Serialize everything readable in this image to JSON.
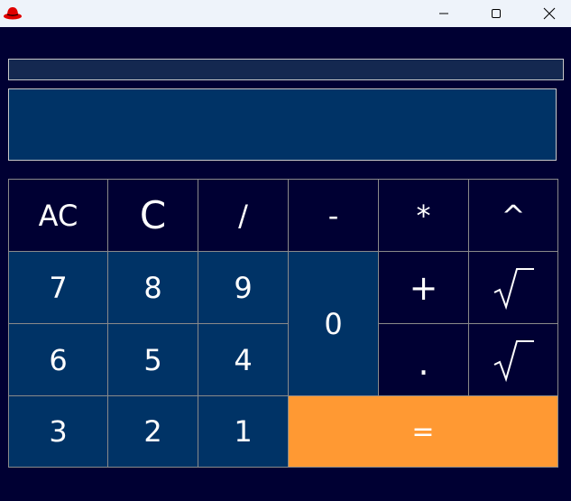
{
  "window": {
    "icon": "red-hat-icon",
    "controls": {
      "minimize": "minimize-icon",
      "maximize": "maximize-icon",
      "close": "close-icon"
    }
  },
  "display": {
    "expression": "",
    "result": ""
  },
  "keypad": {
    "row1": [
      "AC",
      "C",
      "/",
      "-",
      "*",
      "^"
    ],
    "digits_789": [
      "7",
      "8",
      "9"
    ],
    "digits_654": [
      "6",
      "5",
      "4"
    ],
    "digits_321": [
      "3",
      "2",
      "1"
    ],
    "zero": "0",
    "plus": "+",
    "dot": ".",
    "equals": "=",
    "sqrt_icon": "square-root-icon"
  },
  "colors": {
    "background": "#000033",
    "key_blue": "#003366",
    "equals_orange": "#ff9933",
    "border": "#8a8a8a",
    "titlebar": "#eef3fa"
  }
}
